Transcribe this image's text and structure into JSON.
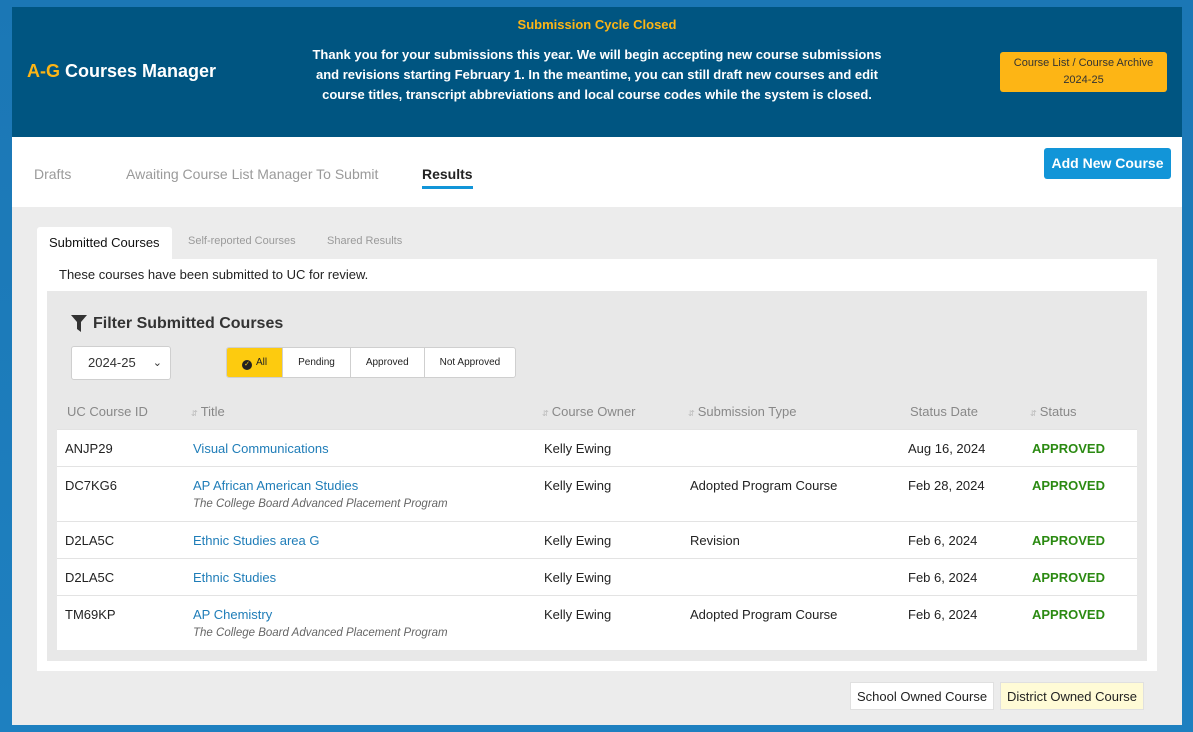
{
  "header": {
    "brand_accent": "A-G",
    "brand_rest": " Courses Manager",
    "notice_title": "Submission Cycle Closed",
    "notice_lines": [
      "Thank you for your submissions this year. We will begin accepting new course submissions",
      "and revisions starting February 1. In the meantime, you can still draft new courses and edit",
      "course titles, transcript abbreviations and local course codes while the system is closed."
    ],
    "archive_line1": "Course List / Course Archive",
    "archive_line2": "2024-25"
  },
  "top_tabs": [
    {
      "label": "Drafts",
      "active": false
    },
    {
      "label": "Awaiting Course List Manager To Submit",
      "active": false
    },
    {
      "label": "Results",
      "active": true
    }
  ],
  "add_button": "Add New Course",
  "sub_tabs": [
    {
      "label": "Submitted Courses",
      "active": true
    },
    {
      "label": "Self-reported Courses",
      "active": false
    },
    {
      "label": "Shared Results",
      "active": false
    }
  ],
  "panel_description": "These courses have been submitted to UC for review.",
  "filter": {
    "title": "Filter Submitted Courses",
    "year_value": "2024-25",
    "status_options": [
      "All",
      "Pending",
      "Approved",
      "Not Approved"
    ],
    "status_selected": "All"
  },
  "table": {
    "columns": [
      "UC Course ID",
      "Title",
      "Course Owner",
      "Submission Type",
      "Status Date",
      "Status"
    ],
    "rows": [
      {
        "id": "ANJP29",
        "title": "Visual Communications",
        "subtitle": "",
        "owner": "Kelly Ewing",
        "type": "",
        "date": "Aug 16, 2024",
        "status": "APPROVED"
      },
      {
        "id": "DC7KG6",
        "title": "AP African American Studies",
        "subtitle": "The College Board Advanced Placement Program",
        "owner": "Kelly Ewing",
        "type": "Adopted Program Course",
        "date": "Feb 28, 2024",
        "status": "APPROVED"
      },
      {
        "id": "D2LA5C",
        "title": "Ethnic Studies area G",
        "subtitle": "",
        "owner": "Kelly Ewing",
        "type": "Revision",
        "date": "Feb 6, 2024",
        "status": "APPROVED"
      },
      {
        "id": "D2LA5C",
        "title": "Ethnic Studies",
        "subtitle": "",
        "owner": "Kelly Ewing",
        "type": "",
        "date": "Feb 6, 2024",
        "status": "APPROVED"
      },
      {
        "id": "TM69KP",
        "title": "AP Chemistry",
        "subtitle": "The College Board Advanced Placement Program",
        "owner": "Kelly Ewing",
        "type": "Adopted Program Course",
        "date": "Feb 6, 2024",
        "status": "APPROVED"
      }
    ]
  },
  "legend": {
    "school": "School Owned Course",
    "district": "District Owned Course"
  },
  "colors": {
    "header_bg": "#005581",
    "accent_gold": "#fdb515",
    "primary_blue": "#1295d8",
    "approved_green": "#2b8a12",
    "district_bg": "#fffbd6"
  },
  "icons": {
    "filter": "funnel-icon",
    "select": "chevron-down-icon",
    "selected_option": "check-circle-icon",
    "sort": "sort-icon"
  }
}
